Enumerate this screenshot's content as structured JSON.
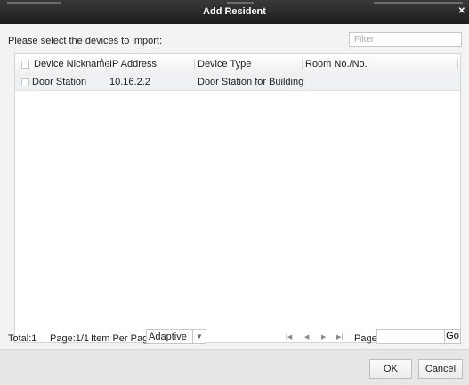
{
  "window": {
    "title": "Add Resident"
  },
  "dialog": {
    "prompt": "Please select the devices to import:",
    "filter_placeholder": "Filter"
  },
  "table": {
    "columns": [
      "Device Nickname",
      "IP Address",
      "Device Type",
      "Room No./No."
    ],
    "rows": [
      {
        "nickname": "Door Station",
        "ip": "10.16.2.2",
        "type": "Door Station for Building",
        "room": ""
      }
    ]
  },
  "footer": {
    "total": "Total:1",
    "page": "Page:1/1",
    "items_per_page_label": "Item Per Page:",
    "items_per_page_value": "Adaptive",
    "page_label": "Page",
    "go_label": "Go"
  },
  "buttons": {
    "ok": "OK",
    "cancel": "Cancel"
  }
}
